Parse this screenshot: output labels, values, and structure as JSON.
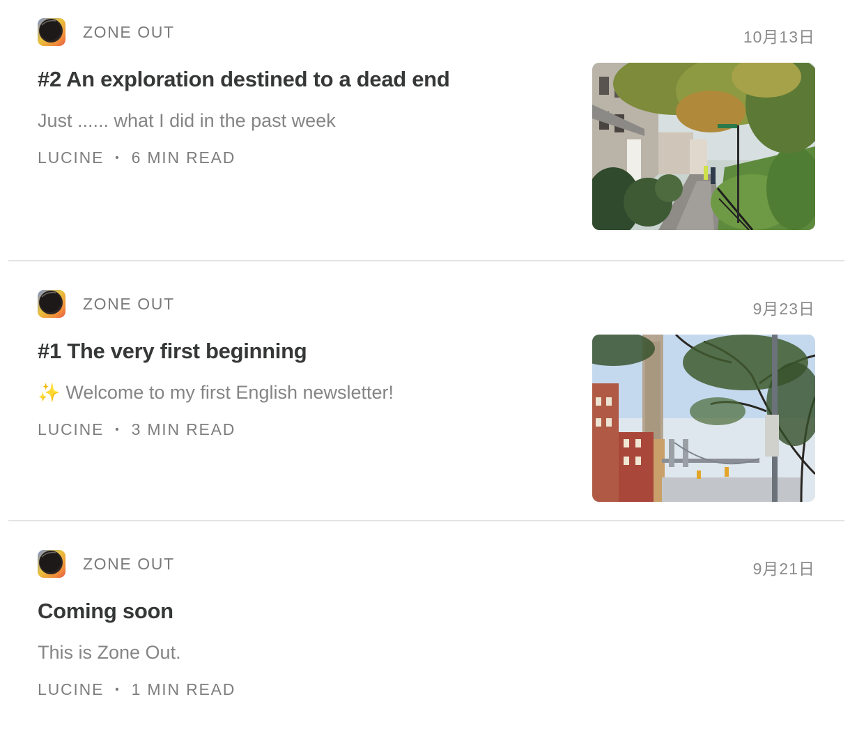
{
  "publication": {
    "name": "ZONE OUT",
    "logo_icon": "zone-out-logo-icon"
  },
  "posts": [
    {
      "date": "10月13日",
      "title": "#2 An exploration destined to a dead end",
      "subtitle": "Just ...... what I did in the past week",
      "author": "LUCINE",
      "separator": "•",
      "read_time": "6 MIN READ",
      "thumbnail": "street-trees-photo"
    },
    {
      "date": "9月23日",
      "title": "#1 The very first beginning",
      "subtitle_emoji": "✨",
      "subtitle": "Welcome to my first English newsletter!",
      "author": "LUCINE",
      "separator": "•",
      "read_time": "3 MIN READ",
      "thumbnail": "bridge-street-photo"
    },
    {
      "date": "9月21日",
      "title": "Coming soon",
      "subtitle": "This is Zone Out.",
      "author": "LUCINE",
      "separator": "•",
      "read_time": "1 MIN READ"
    }
  ],
  "colors": {
    "title": "#363737",
    "muted": "#858585",
    "divider": "#e4e4e4",
    "logo_ring": "#f2a93b"
  }
}
